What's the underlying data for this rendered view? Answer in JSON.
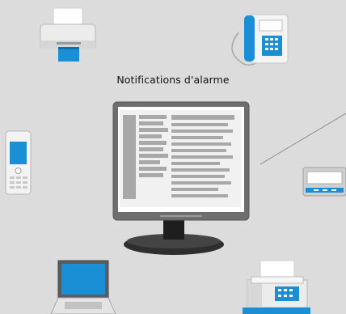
{
  "diagram": {
    "title": "Notifications d'alarme",
    "devices": [
      {
        "id": "printer",
        "icon": "printer-icon"
      },
      {
        "id": "desk-phone",
        "icon": "desk-phone-icon"
      },
      {
        "id": "mobile-phone",
        "icon": "mobile-phone-icon"
      },
      {
        "id": "monitor",
        "icon": "monitor-icon"
      },
      {
        "id": "pager",
        "icon": "pager-icon"
      },
      {
        "id": "laptop",
        "icon": "laptop-icon"
      },
      {
        "id": "fax",
        "icon": "fax-icon"
      }
    ],
    "colors": {
      "background": "#dcdcdc",
      "accent": "#1a8fd6",
      "device_body": "#f2f2f2",
      "device_shadow": "#9a9a9a",
      "connector": "#8c8c8c"
    }
  }
}
